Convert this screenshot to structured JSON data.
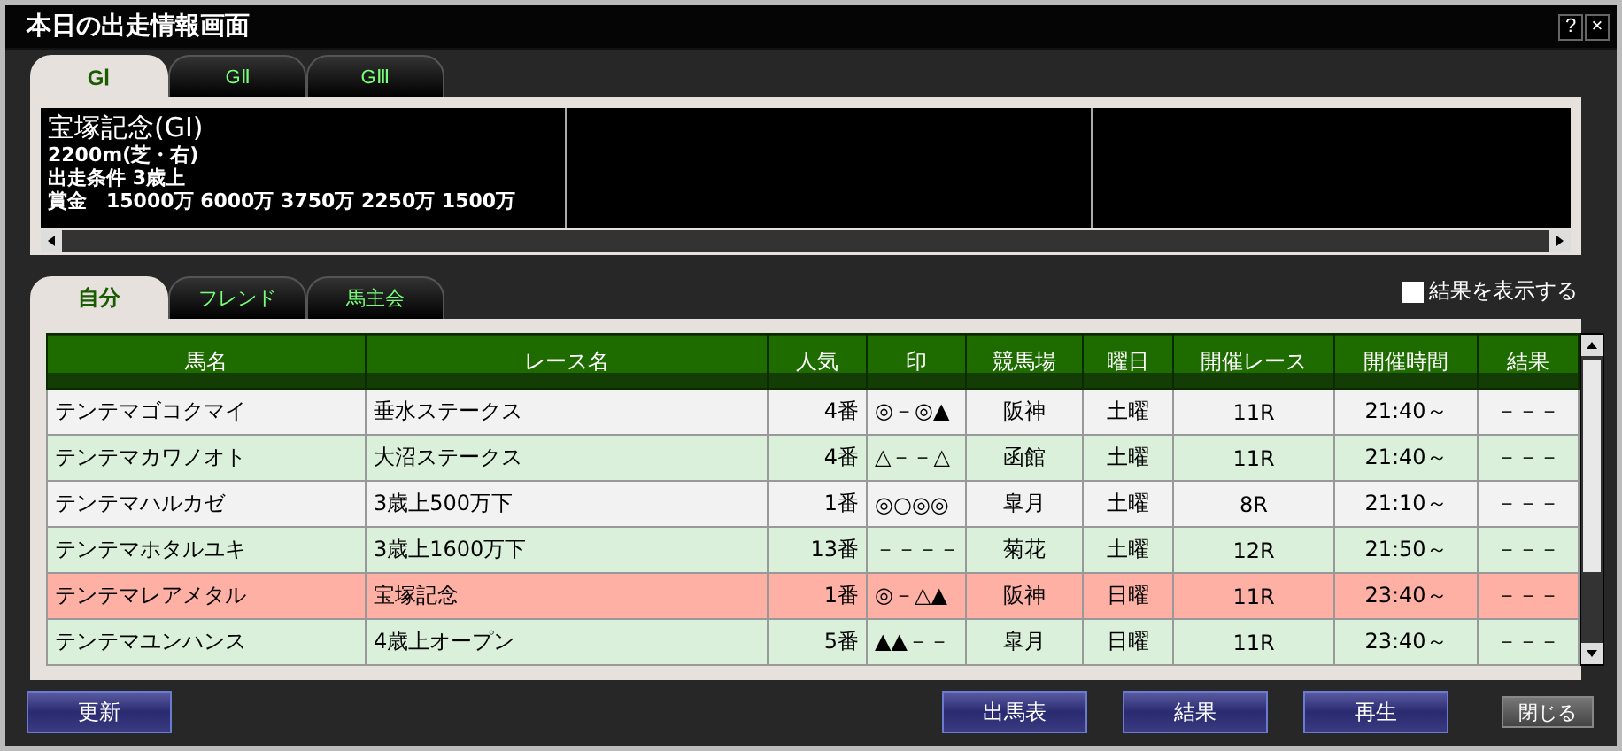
{
  "window": {
    "title": "本日の出走情報画面",
    "help": "?",
    "close": "×"
  },
  "grade_tabs": [
    {
      "label": "GⅠ",
      "selected": true
    },
    {
      "label": "GⅡ",
      "selected": false
    },
    {
      "label": "GⅢ",
      "selected": false
    }
  ],
  "race_info": {
    "name": "宝塚記念(GⅠ)",
    "distance": "2200m(芝・右)",
    "condition": "出走条件 3歳上",
    "prize": "賞金　15000万 6000万 3750万 2250万 1500万"
  },
  "group_tabs": [
    {
      "label": "自分",
      "selected": true
    },
    {
      "label": "フレンド",
      "selected": false
    },
    {
      "label": "馬主会",
      "selected": false
    }
  ],
  "show_results": {
    "label": "結果を表示する",
    "checked": false
  },
  "table": {
    "columns": [
      "馬名",
      "レース名",
      "人気",
      "印",
      "競馬場",
      "曜日",
      "開催レース",
      "開催時間",
      "結果"
    ],
    "rows": [
      {
        "cells": [
          "テンテマゴコクマイ",
          "垂水ステークス",
          "4番",
          "◎－◎▲",
          "阪神",
          "土曜",
          "11R",
          "21:40～",
          "－－－"
        ],
        "highlighted": false
      },
      {
        "cells": [
          "テンテマカワノオト",
          "大沼ステークス",
          "4番",
          "△－－△",
          "函館",
          "土曜",
          "11R",
          "21:40～",
          "－－－"
        ],
        "highlighted": false
      },
      {
        "cells": [
          "テンテマハルカゼ",
          "3歳上500万下",
          "1番",
          "◎○◎◎",
          "皐月",
          "土曜",
          "8R",
          "21:10～",
          "－－－"
        ],
        "highlighted": false
      },
      {
        "cells": [
          "テンテマホタルユキ",
          "3歳上1600万下",
          "13番",
          "－－－－",
          "菊花",
          "土曜",
          "12R",
          "21:50～",
          "－－－"
        ],
        "highlighted": false
      },
      {
        "cells": [
          "テンテマレアメタル",
          "宝塚記念",
          "1番",
          "◎－△▲",
          "阪神",
          "日曜",
          "11R",
          "23:40～",
          "－－－"
        ],
        "highlighted": true
      },
      {
        "cells": [
          "テンテマユンハンス",
          "4歳上オープン",
          "5番",
          "▲▲－－",
          "皐月",
          "日曜",
          "11R",
          "23:40～",
          "－－－"
        ],
        "highlighted": false
      }
    ]
  },
  "buttons": {
    "refresh": "更新",
    "entries": "出馬表",
    "results": "結果",
    "replay": "再生",
    "close": "閉じる"
  }
}
